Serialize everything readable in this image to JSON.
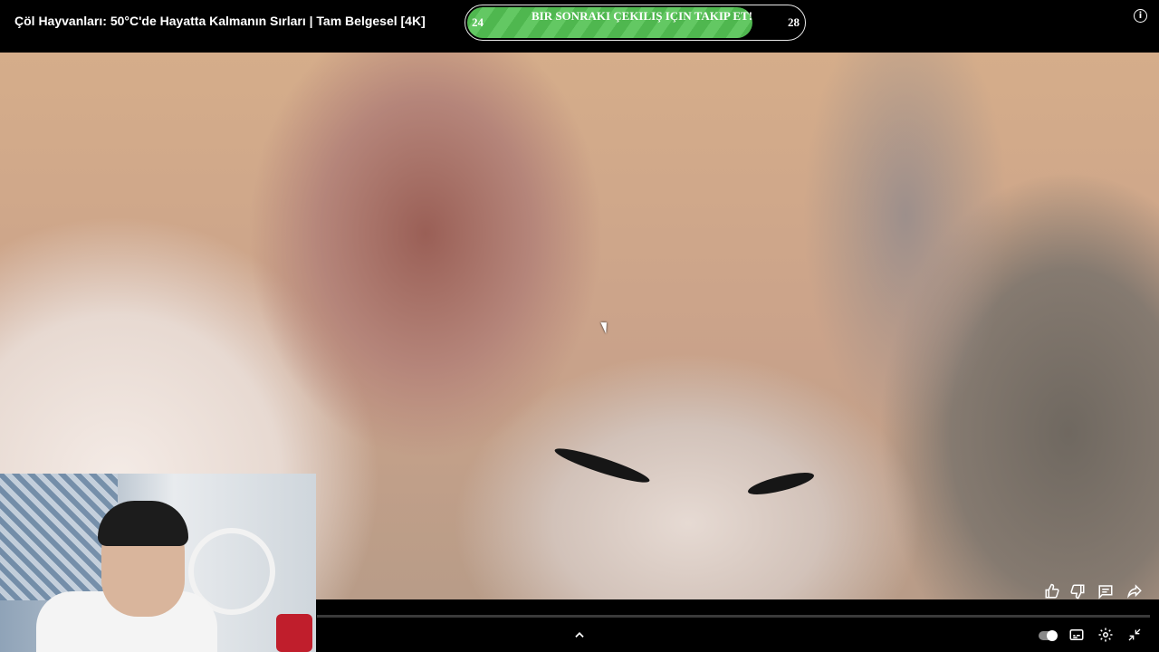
{
  "header": {
    "title": "Çöl Hayvanları: 50°C'de Hayatta Kalmanın Sırları | Tam Belgesel [4K]",
    "info_icon": "info-icon"
  },
  "giveaway": {
    "left_number": "24",
    "text": "BIR SONRAKI ÇEKILIŞ IÇIN TAKIP ET!",
    "right_number": "28",
    "progress_fraction": 0.85,
    "fill_color": "#4fb74f"
  },
  "actions": {
    "icons": [
      "like-icon",
      "dislike-icon",
      "comment-icon",
      "share-icon"
    ]
  },
  "controls": {
    "icons": [
      "chevron-up-icon",
      "autoplay-toggle",
      "captions-icon",
      "settings-icon",
      "exit-fullscreen-icon"
    ]
  }
}
